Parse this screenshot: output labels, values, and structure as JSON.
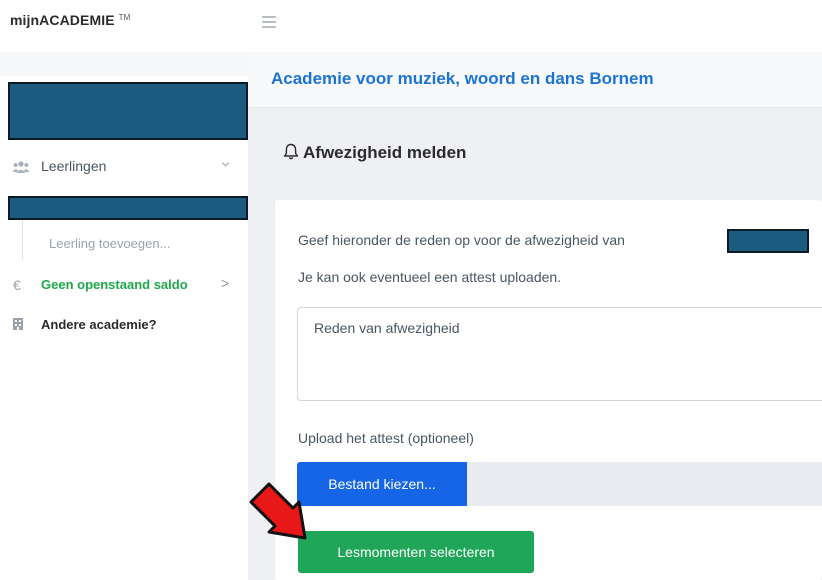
{
  "app": {
    "brand": "mijnACADEMIE",
    "trademark": "TM"
  },
  "sidebar": {
    "leerlingen_label": "Leerlingen",
    "sub_item_label": "Leerling toevoegen...",
    "saldo_symbol": "€",
    "saldo_label": "Geen openstaand saldo",
    "saldo_chevron": ">",
    "academie_label": "Andere academie?"
  },
  "main": {
    "header_title": "Academie voor muziek, woord en dans Bornem",
    "section_title": "Afwezigheid melden",
    "form": {
      "intro_text": "Geef hieronder de reden op voor de afwezigheid van",
      "attest_hint": "Je kan ook eventueel een attest uploaden.",
      "reason_placeholder": "Reden van afwezigheid",
      "reason_value": "",
      "upload_label": "Upload het attest (optioneel)",
      "file_button_label": "Bestand kiezen...",
      "submit_label": "Lesmomenten selecteren"
    }
  },
  "colors": {
    "accent_blue": "#1b74d2",
    "file_button": "#1565e6",
    "submit_green": "#1fa658",
    "saldo_green": "#1fa84a",
    "redaction": "#1c5b80",
    "annotation_arrow": "#e81818"
  },
  "icons": {
    "menu": "hamburger-icon",
    "students": "users-icon",
    "expand": "chevron-down-icon",
    "euro": "euro-icon",
    "building": "building-icon",
    "bell": "bell-icon",
    "annotation": "red-arrow-icon"
  }
}
